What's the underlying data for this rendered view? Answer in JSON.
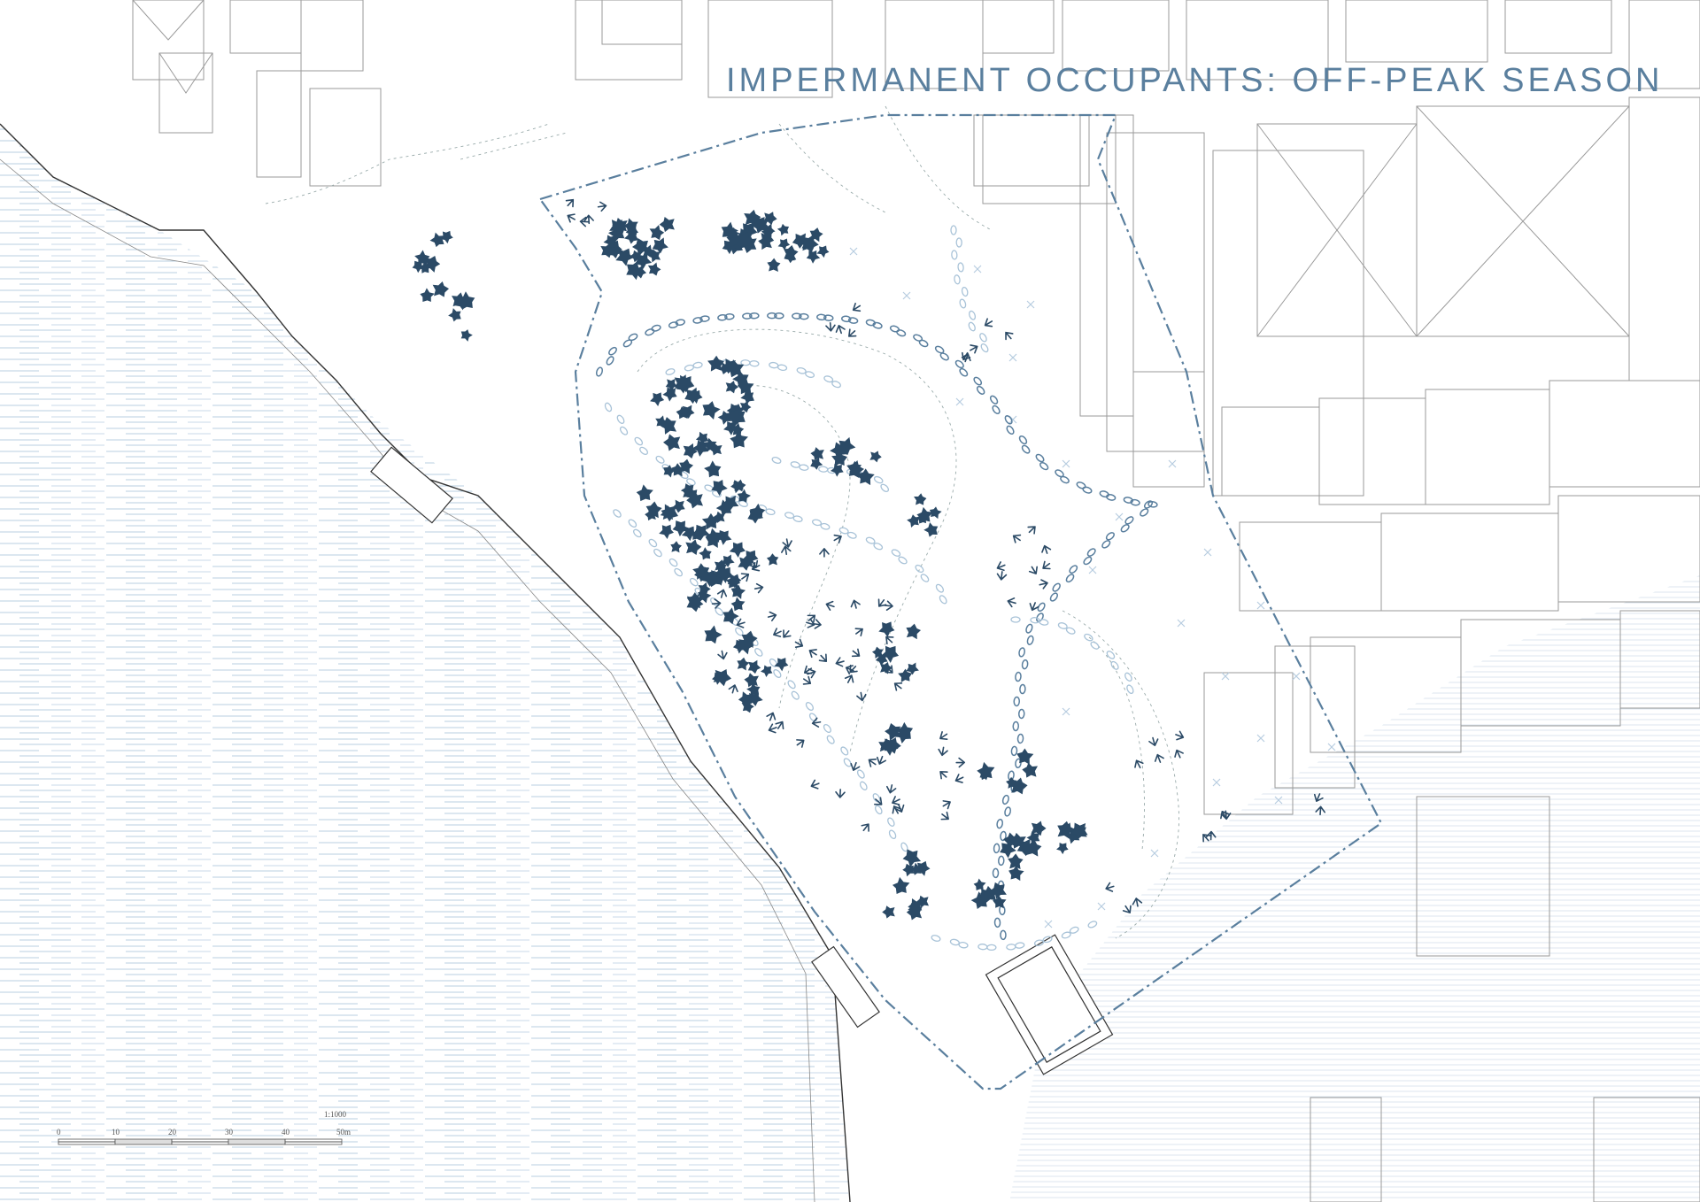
{
  "title": "IMPERMANENT OCCUPANTS: OFF-PEAK SEASON",
  "scale": {
    "ratio": "1:1000",
    "ticks": [
      "0",
      "10",
      "20",
      "30",
      "40",
      "50m"
    ]
  },
  "colors": {
    "accent": "#5a7f9e",
    "dark_marks": "#2b4a66",
    "light_marks": "#a9c3d8",
    "water_lines": "#b8cfe0",
    "building_lines": "#9a9a9a"
  },
  "legend_icons": [
    "tree-icon",
    "bird-track-icon",
    "footprint-icon",
    "cross-marker-icon"
  ]
}
